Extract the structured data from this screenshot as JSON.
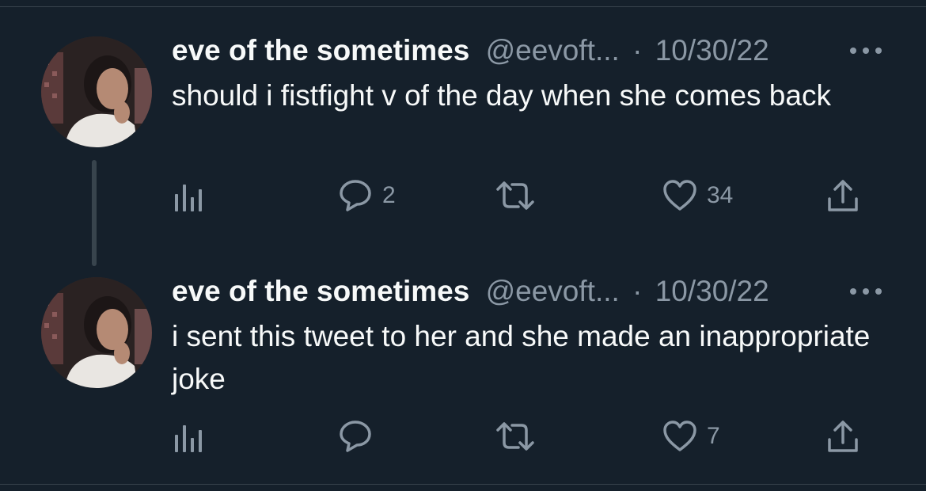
{
  "colors": {
    "background": "#15202b",
    "text_primary": "#f7f9f9",
    "text_secondary": "#8b98a5",
    "divider": "#38444d"
  },
  "tweets": [
    {
      "display_name": "eve of the sometimes",
      "handle": "@eevoft...",
      "separator": "·",
      "date": "10/30/22",
      "text": "should i fistfight v of the day when she comes back",
      "reply_count": "2",
      "retweet_count": "",
      "like_count": "34"
    },
    {
      "display_name": "eve of the sometimes",
      "handle": "@eevoft...",
      "separator": "·",
      "date": "10/30/22",
      "text": "i sent this tweet to her and she made an inappropriate joke",
      "reply_count": "",
      "retweet_count": "",
      "like_count": "7"
    }
  ],
  "icons": {
    "avatar": "user-photo",
    "more": "more-horizontal-icon",
    "views": "analytics-icon",
    "reply": "reply-bubble-icon",
    "retweet": "retweet-icon",
    "like": "heart-icon",
    "share": "share-upload-icon"
  }
}
